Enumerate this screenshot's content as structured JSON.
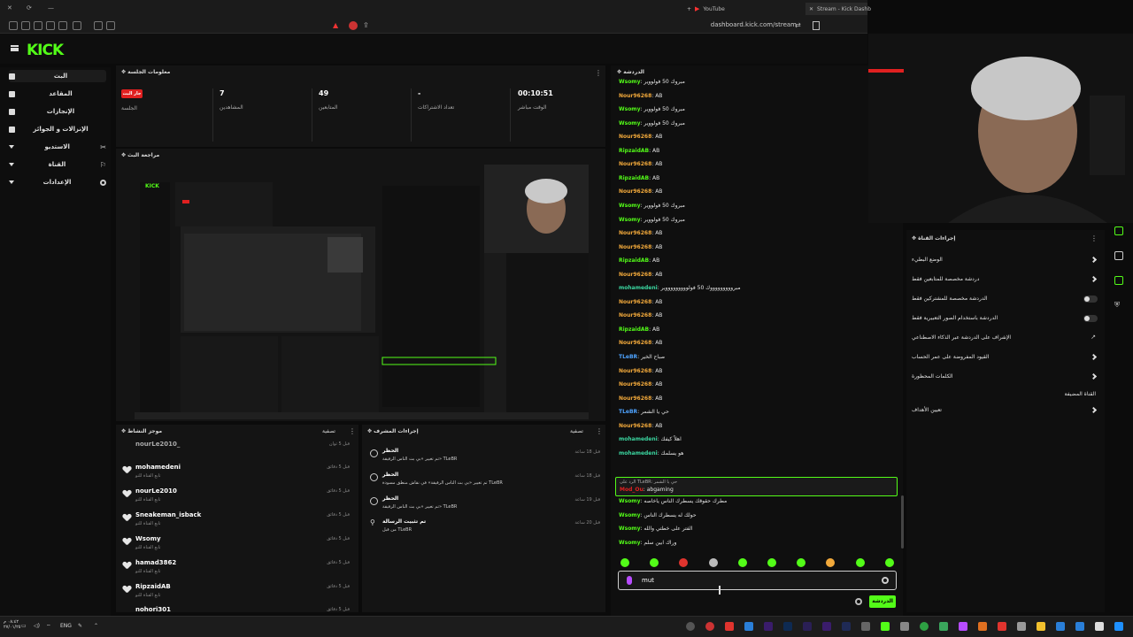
{
  "browser": {
    "tabs": [
      {
        "label": "YouTube"
      },
      {
        "label": "Stream - Kick Dashb"
      }
    ],
    "url": "dashboard.kick.com/stream"
  },
  "header": {
    "logo": "KICK"
  },
  "sidebar": {
    "items": [
      {
        "label": "البث"
      },
      {
        "label": "المقاعد"
      },
      {
        "label": "الإنجازات"
      },
      {
        "label": "الإنزالات و الجوائز"
      },
      {
        "label": "الاستديو"
      },
      {
        "label": "القناة"
      },
      {
        "label": "الإعدادات"
      }
    ]
  },
  "session": {
    "title": "معلومات الجلسة",
    "live_badge": "جار البث",
    "live_label": "الجلسة",
    "stats": [
      {
        "value": "7",
        "label": "المشاهدين"
      },
      {
        "value": "49",
        "label": "المتابعين"
      },
      {
        "value": "-",
        "label": "تعداد الاشتراكات"
      },
      {
        "value": "00:10:51",
        "label": "الوقت مباشر"
      }
    ]
  },
  "preview": {
    "title": "مراجعة البث"
  },
  "activity": {
    "title": "موجز النشاط",
    "filter": "تصفية",
    "items": [
      {
        "name": "nourLe2010_",
        "sub": "تابع القناة للتو",
        "time": "قبل 5 ثوان"
      },
      {
        "name": "mohamedeni",
        "sub": "تابع القناة للتو",
        "time": "قبل 5 دقائق"
      },
      {
        "name": "nourLe2010",
        "sub": "تابع القناة للتو",
        "time": "قبل 5 دقائق"
      },
      {
        "name": "Sneakeman_isback",
        "sub": "تابع القناة للتو",
        "time": "قبل 5 دقائق"
      },
      {
        "name": "Wsomy",
        "sub": "تابع القناة للتو",
        "time": "قبل 5 دقائق"
      },
      {
        "name": "hamad3862",
        "sub": "تابع القناة للتو",
        "time": "قبل 5 دقائق"
      },
      {
        "name": "RipzaidAB",
        "sub": "تابع القناة للتو",
        "time": "قبل 5 دقائق"
      },
      {
        "name": "nohori301",
        "sub": "",
        "time": "قبل 5 دقائق"
      }
    ]
  },
  "modactions": {
    "title": "إجراءات المشرف",
    "filter": "تصفية",
    "items": [
      {
        "title": "الحظر",
        "desc": "تم تغيير «بي بث الناس الرفيقة» TLeBR",
        "time": "قبل 18 ساعة"
      },
      {
        "title": "الحظر",
        "desc": "تم تغيير «بي بث الناس الرفيقة» في نقاش منطق مسودة TLeBR",
        "time": "قبل 18 ساعة"
      },
      {
        "title": "الحظر",
        "desc": "تم تغيير «بي بث الناس الرفيقة» TLeBR",
        "time": "قبل 19 ساعة"
      },
      {
        "title": "تم تثبيت الرسالة",
        "desc": "من قبل TLeBR",
        "time": "قبل 20 ساعة"
      }
    ]
  },
  "chat": {
    "title": "الدردشة",
    "messages": [
      {
        "user": "Wsomy",
        "color": "#53fc18",
        "text": "مبروك 50 فولووير"
      },
      {
        "user": "Nour96268",
        "color": "#f2a93b",
        "text": "AB"
      },
      {
        "user": "Wsomy",
        "color": "#53fc18",
        "text": "مبروك 50 فولووير"
      },
      {
        "user": "Wsomy",
        "color": "#53fc18",
        "text": "مبروك 50 فولووير"
      },
      {
        "user": "Nour96268",
        "color": "#f2a93b",
        "text": "AB"
      },
      {
        "user": "RipzaidAB",
        "color": "#53fc18",
        "text": "AB"
      },
      {
        "user": "Nour96268",
        "color": "#f2a93b",
        "text": "AB"
      },
      {
        "user": "RipzaidAB",
        "color": "#53fc18",
        "text": "AB"
      },
      {
        "user": "Nour96268",
        "color": "#f2a93b",
        "text": "AB"
      },
      {
        "user": "Wsomy",
        "color": "#53fc18",
        "text": "مبروك 50 فولووير"
      },
      {
        "user": "Wsomy",
        "color": "#53fc18",
        "text": "مبروك 50 فولووير"
      },
      {
        "user": "Nour96268",
        "color": "#f2a93b",
        "text": "AB"
      },
      {
        "user": "Nour96268",
        "color": "#f2a93b",
        "text": "AB"
      },
      {
        "user": "RipzaidAB",
        "color": "#53fc18",
        "text": "AB"
      },
      {
        "user": "Nour96268",
        "color": "#f2a93b",
        "text": "AB"
      },
      {
        "user": "mohamedeni",
        "color": "#3bd6a0",
        "text": "مبروووووووووك 50 فولوووووووووير"
      },
      {
        "user": "Nour96268",
        "color": "#f2a93b",
        "text": "AB"
      },
      {
        "user": "Nour96268",
        "color": "#f2a93b",
        "text": "AB"
      },
      {
        "user": "RipzaidAB",
        "color": "#53fc18",
        "text": "AB"
      },
      {
        "user": "Nour96268",
        "color": "#f2a93b",
        "text": "AB"
      },
      {
        "user": "TLeBR",
        "color": "#4ea3ff",
        "text": "صباح الخير"
      },
      {
        "user": "Nour96268",
        "color": "#f2a93b",
        "text": "AB"
      },
      {
        "user": "Nour96268",
        "color": "#f2a93b",
        "text": "AB"
      },
      {
        "user": "Nour96268",
        "color": "#f2a93b",
        "text": "AB"
      },
      {
        "user": "TLeBR",
        "color": "#4ea3ff",
        "text": "حي يا الشمر"
      },
      {
        "user": "Nour96268",
        "color": "#f2a93b",
        "text": "AB"
      },
      {
        "user": "mohamedeni",
        "color": "#3bd6a0",
        "text": "اهلاً كيفك"
      },
      {
        "user": "mohamedeni",
        "color": "#3bd6a0",
        "text": "هو يسلمك"
      }
    ],
    "reply": {
      "ref": "الرد على TLeBR: حي يا الشمر",
      "user": "Mod_Ou",
      "text": "abgaming"
    },
    "messages2": [
      {
        "user": "Wsomy",
        "color": "#53fc18",
        "text": "مطرك حقوقك يسطرك الناس ياخاصه"
      },
      {
        "user": "Wsomy",
        "color": "#53fc18",
        "text": "حولك له يسطرك الناس"
      },
      {
        "user": "Wsomy",
        "color": "#53fc18",
        "text": "الفتر على خطتي والله"
      },
      {
        "user": "Wsomy",
        "color": "#53fc18",
        "text": "وراك ابين سلم"
      }
    ],
    "input_value": "mut",
    "send_label": "الدردشة"
  },
  "channel_actions": {
    "title": "إجراءات القناة",
    "items": [
      {
        "label": "الوضع البطيء",
        "control": "arrow"
      },
      {
        "label": "دردشة مخصصة للمتابعين فقط",
        "control": "arrow"
      },
      {
        "label": "الدردشة مخصصة للمشتركين فقط",
        "control": "toggle"
      },
      {
        "label": "الدردشة باستخدام الصور التعبيرية فقط",
        "control": "toggle"
      },
      {
        "label": "الإشراف على الدردشة عبر الذكاء الاصطناعي",
        "control": "external"
      },
      {
        "label": "القيود المفروضة على عمر الحساب",
        "control": "arrow"
      },
      {
        "label": "الكلمات المحظورة",
        "control": "arrow"
      },
      {
        "label": "القناة المضيفة",
        "control": "none"
      },
      {
        "label": "تعيين الأهداف",
        "control": "arrow"
      }
    ]
  },
  "taskbar": {
    "lang": "ENG",
    "time": "٠٨:٤٢ م",
    "date": "٢٧/٠١/٢٥"
  },
  "colors": {
    "accent": "#53fc18",
    "live": "#e02020",
    "bg": "#0b0b0b"
  }
}
